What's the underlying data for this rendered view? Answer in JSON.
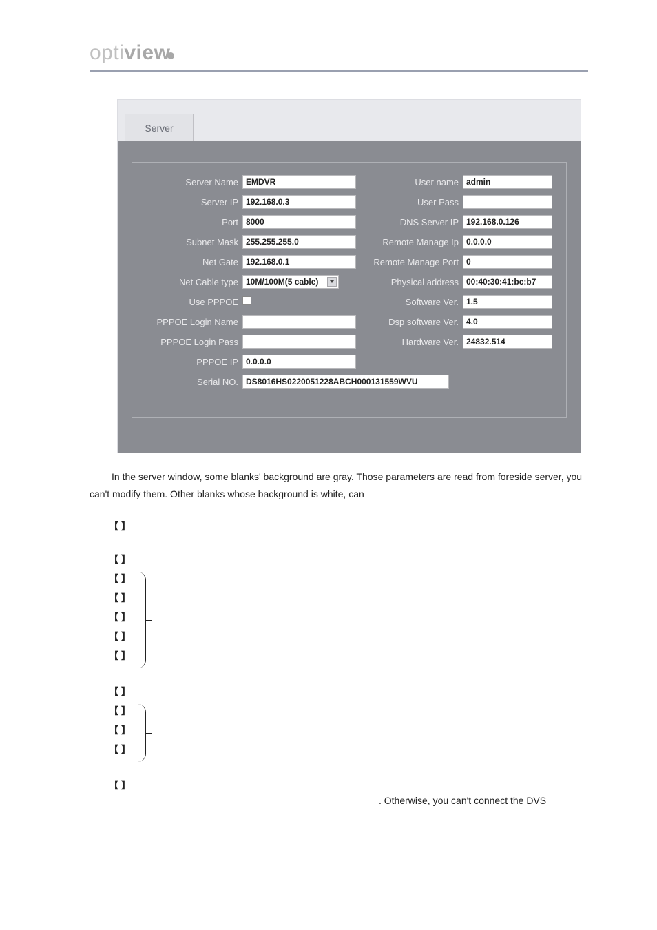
{
  "logo": {
    "part1": "opti",
    "part2": "view"
  },
  "tab_label": "Server",
  "form": {
    "server_name": {
      "label": "Server Name",
      "value": "EMDVR"
    },
    "server_ip": {
      "label": "Server IP",
      "value": "192.168.0.3"
    },
    "port": {
      "label": "Port",
      "value": "8000"
    },
    "subnet_mask": {
      "label": "Subnet Mask",
      "value": "255.255.255.0"
    },
    "net_gate": {
      "label": "Net Gate",
      "value": "192.168.0.1"
    },
    "net_cable_type": {
      "label": "Net Cable type",
      "value": "10M/100M(5 cable)"
    },
    "use_pppoe": {
      "label": "Use PPPOE"
    },
    "pppoe_login_name": {
      "label": "PPPOE Login Name",
      "value": ""
    },
    "pppoe_login_pass": {
      "label": "PPPOE Login Pass",
      "value": ""
    },
    "pppoe_ip": {
      "label": "PPPOE IP",
      "value": "0.0.0.0"
    },
    "serial_no": {
      "label": "Serial NO.",
      "value": "DS8016HS0220051228ABCH000131559WVU"
    },
    "user_name": {
      "label": "User name",
      "value": "admin"
    },
    "user_pass": {
      "label": "User Pass",
      "value": ""
    },
    "dns_server_ip": {
      "label": "DNS Server IP",
      "value": "192.168.0.126"
    },
    "remote_manage_ip": {
      "label": "Remote Manage Ip",
      "value": "0.0.0.0"
    },
    "remote_manage_port": {
      "label": "Remote Manage Port",
      "value": "0"
    },
    "physical_address": {
      "label": "Physical address",
      "value": "00:40:30:41:bc:b7"
    },
    "software_ver": {
      "label": "Software Ver.",
      "value": "1.5"
    },
    "dsp_software_ver": {
      "label": "Dsp software Ver.",
      "value": "4.0"
    },
    "hardware_ver": {
      "label": "Hardware Ver.",
      "value": "24832.514"
    }
  },
  "paragraph1": "In the server window, some blanks' background are gray. Those parameters are read from foreside server, you can't modify them. Other blanks whose background is white, can",
  "trailing_text": ". Otherwise, you can't connect the DVS",
  "brackets": {
    "b1": "【                      】",
    "b2": "【                                                  】",
    "b3": "【                  】",
    "b4": "【        】",
    "b5": "【                       】",
    "b6": "【                 】",
    "b7": "【                           】",
    "b8": "【                                                                                          】",
    "b9": "【                     】",
    "b10": "【                                  】",
    "b11": "【                                  】",
    "b12": "【                  】"
  }
}
